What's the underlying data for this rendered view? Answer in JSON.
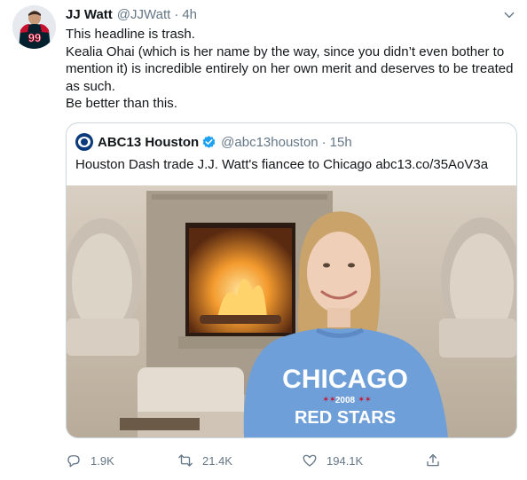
{
  "author": {
    "name": "JJ Watt",
    "handle": "@JJWatt",
    "separator": "·",
    "time": "4h",
    "jersey_number": "99"
  },
  "body": {
    "line1": "This headline is trash.",
    "line2": "Kealia Ohai (which is her name by the way, since you didn’t even bother to mention it) is incredible entirely on her own merit and deserves to be treated as such.",
    "line3": "Be better than this."
  },
  "quoted": {
    "name": "ABC13 Houston",
    "verified": true,
    "handle": "@abc13houston",
    "separator": "·",
    "time": "15h",
    "text": "Houston Dash trade J.J. Watt's fiancee to Chicago",
    "link": "abc13.co/35AoV3a",
    "photo": {
      "sweatshirt_line1": "CHICAGO",
      "sweatshirt_year": "2008",
      "sweatshirt_line2": "RED STARS"
    }
  },
  "actions": {
    "replies": "1.9K",
    "retweets": "21.4K",
    "likes": "194.1K"
  },
  "icons": {
    "caret": "chevron-down-icon",
    "reply": "reply-icon",
    "retweet": "retweet-icon",
    "like": "heart-icon",
    "share": "share-icon",
    "verified": "verified-badge-icon"
  },
  "colors": {
    "text": "#14171a",
    "secondary": "#657786",
    "verified": "#1da1f2",
    "border": "#ccd6dd",
    "texans_red": "#c8102e",
    "texans_navy": "#03202f",
    "sweatshirt_blue": "#6f9fd8"
  }
}
